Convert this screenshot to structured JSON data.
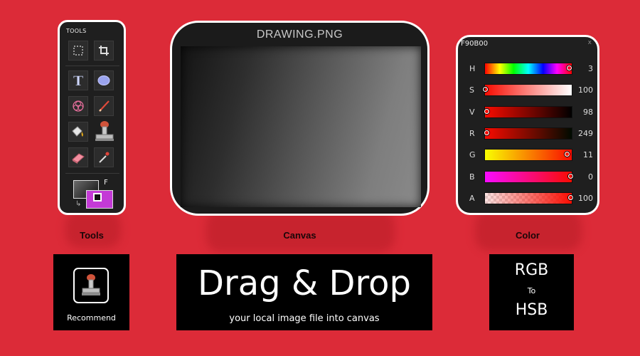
{
  "tools_panel": {
    "title": "TOOLS",
    "tools": [
      "marquee-select",
      "crop",
      "text",
      "ellipse",
      "spirograph",
      "brush",
      "fill-bucket",
      "stamp",
      "eraser",
      "eyedropper"
    ],
    "fg_label": "F",
    "fg_color": "#c43ad6"
  },
  "canvas_panel": {
    "title": "DRAWING.PNG"
  },
  "color_panel": {
    "hex": "F90B00",
    "close_label": "x",
    "rows": [
      {
        "label": "H",
        "value": "3",
        "fraction": 0.98
      },
      {
        "label": "S",
        "value": "100",
        "fraction": 0.0
      },
      {
        "label": "V",
        "value": "98",
        "fraction": 0.02
      },
      {
        "label": "R",
        "value": "249",
        "fraction": 0.02
      },
      {
        "label": "G",
        "value": "11",
        "fraction": 0.96
      },
      {
        "label": "B",
        "value": "0",
        "fraction": 1.0
      },
      {
        "label": "A",
        "value": "100",
        "fraction": 1.0
      }
    ]
  },
  "captions": {
    "tools": "Tools",
    "canvas": "Canvas",
    "color": "Color"
  },
  "recommend_box": {
    "label": "Recommend",
    "icon": "stamp-icon"
  },
  "dragdrop_box": {
    "title": "Drag & Drop",
    "subtitle": "your local image file into canvas"
  },
  "rgbhsb_box": {
    "line1": "RGB",
    "line2": "To",
    "line3": "HSB"
  },
  "colors": {
    "background": "#dc2b38",
    "panel": "#1f1f1f",
    "panel_border": "#ffffff"
  }
}
